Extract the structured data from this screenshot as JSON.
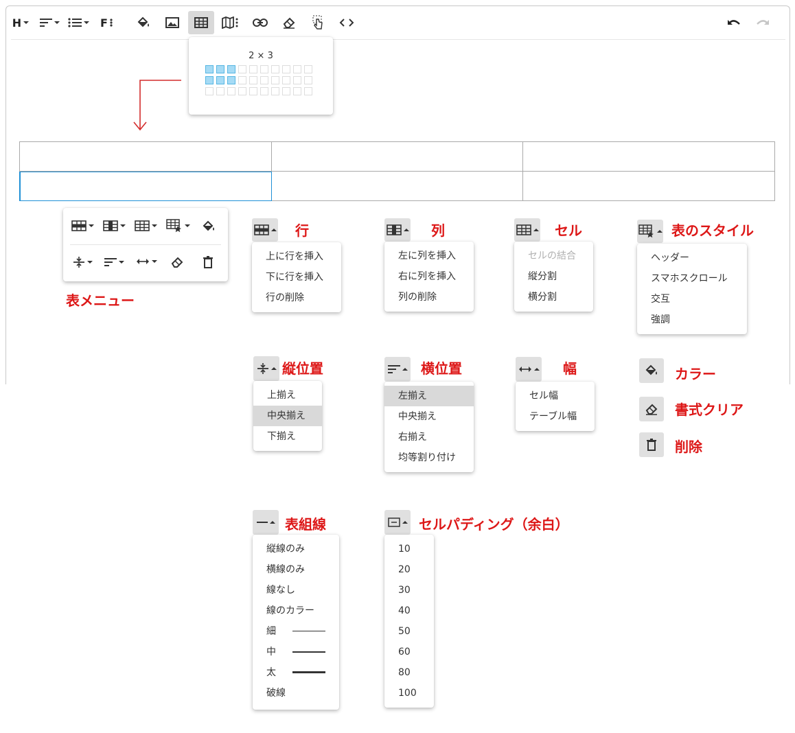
{
  "toolbar": {
    "heading_label": "H",
    "font_label": "F"
  },
  "grid_picker": {
    "label": "2 × 3",
    "rows": 3,
    "cols": 10,
    "selected_rows": 2,
    "selected_cols": 3
  },
  "table_menu_label": "表メニュー",
  "row": {
    "label": "行",
    "items": [
      "上に行を挿入",
      "下に行を挿入",
      "行の削除"
    ]
  },
  "column": {
    "label": "列",
    "items": [
      "左に列を挿入",
      "右に列を挿入",
      "列の削除"
    ]
  },
  "cell": {
    "label": "セル",
    "items": [
      "セルの結合",
      "縦分割",
      "横分割"
    ]
  },
  "table_style": {
    "label": "表のスタイル",
    "items": [
      "ヘッダー",
      "スマホスクロール",
      "交互",
      "強調"
    ]
  },
  "vertical_align": {
    "label": "縦位置",
    "items": [
      "上揃え",
      "中央揃え",
      "下揃え"
    ]
  },
  "horizontal_align": {
    "label": "横位置",
    "items": [
      "左揃え",
      "中央揃え",
      "右揃え",
      "均等割り付け"
    ]
  },
  "width": {
    "label": "幅",
    "items": [
      "セル幅",
      "テーブル幅"
    ]
  },
  "color_label": "カラー",
  "clear_format_label": "書式クリア",
  "delete_label": "削除",
  "border": {
    "label": "表組線",
    "items": [
      "縦線のみ",
      "横線のみ",
      "線なし",
      "線のカラー",
      "細",
      "中",
      "太",
      "破線"
    ]
  },
  "cell_padding": {
    "label": "セルパディング（余白）",
    "items": [
      "10",
      "20",
      "30",
      "40",
      "50",
      "60",
      "80",
      "100"
    ]
  }
}
